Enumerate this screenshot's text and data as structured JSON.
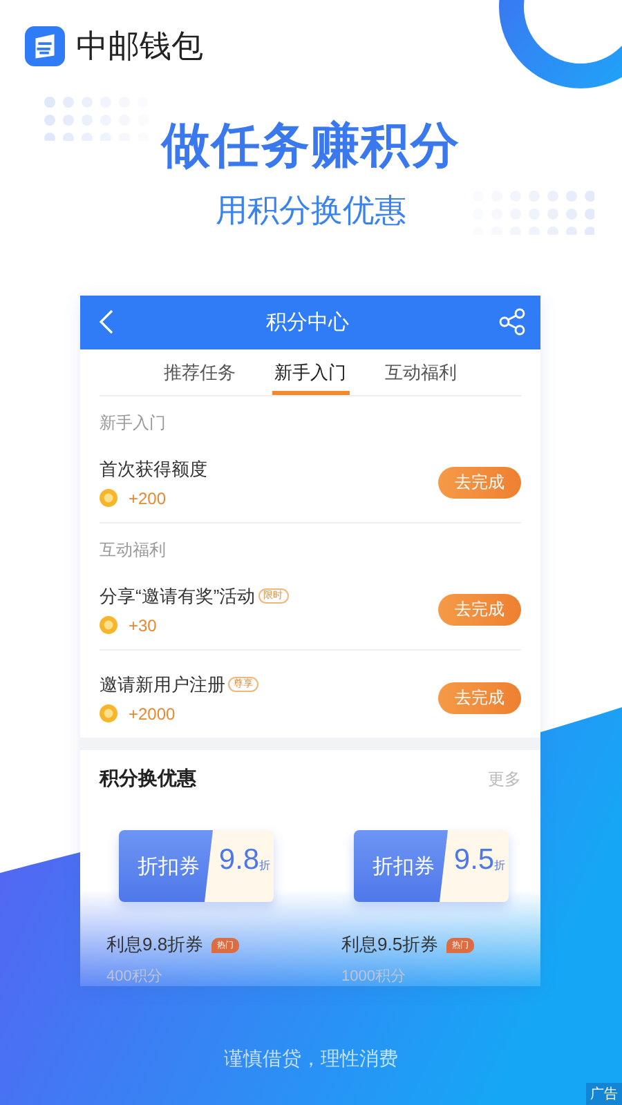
{
  "app": {
    "name": "中邮钱包"
  },
  "headline": "做任务赚积分",
  "subtitle": "用积分换优惠",
  "screen": {
    "title": "积分中心",
    "tabs": [
      {
        "label": "推荐任务",
        "selected": false
      },
      {
        "label": "新手入门",
        "selected": true
      },
      {
        "label": "互动福利",
        "selected": false
      }
    ],
    "sections": [
      {
        "title": "新手入门",
        "tasks": [
          {
            "name": "首次获得额度",
            "points": "+200",
            "button": "去完成"
          }
        ]
      },
      {
        "title": "互动福利",
        "tasks": [
          {
            "name": "分享“邀请有奖”活动",
            "tag": "限时",
            "points": "+30",
            "button": "去完成"
          },
          {
            "name": "邀请新用户注册",
            "tag": "尊享",
            "points": "+2000",
            "button": "去完成"
          }
        ]
      }
    ],
    "exchange": {
      "title": "积分换优惠",
      "more": "更多",
      "coupons": [
        {
          "label": "折扣券",
          "value": "9.8",
          "unit": "折",
          "name": "利息9.8折券",
          "badge": "热门",
          "cost": "400积分"
        },
        {
          "label": "折扣券",
          "value": "9.5",
          "unit": "折",
          "name": "利息9.5折券",
          "badge": "热门",
          "cost": "1000积分"
        }
      ]
    }
  },
  "footer": "谨慎借贷，理性消费",
  "ad_label": "广告"
}
